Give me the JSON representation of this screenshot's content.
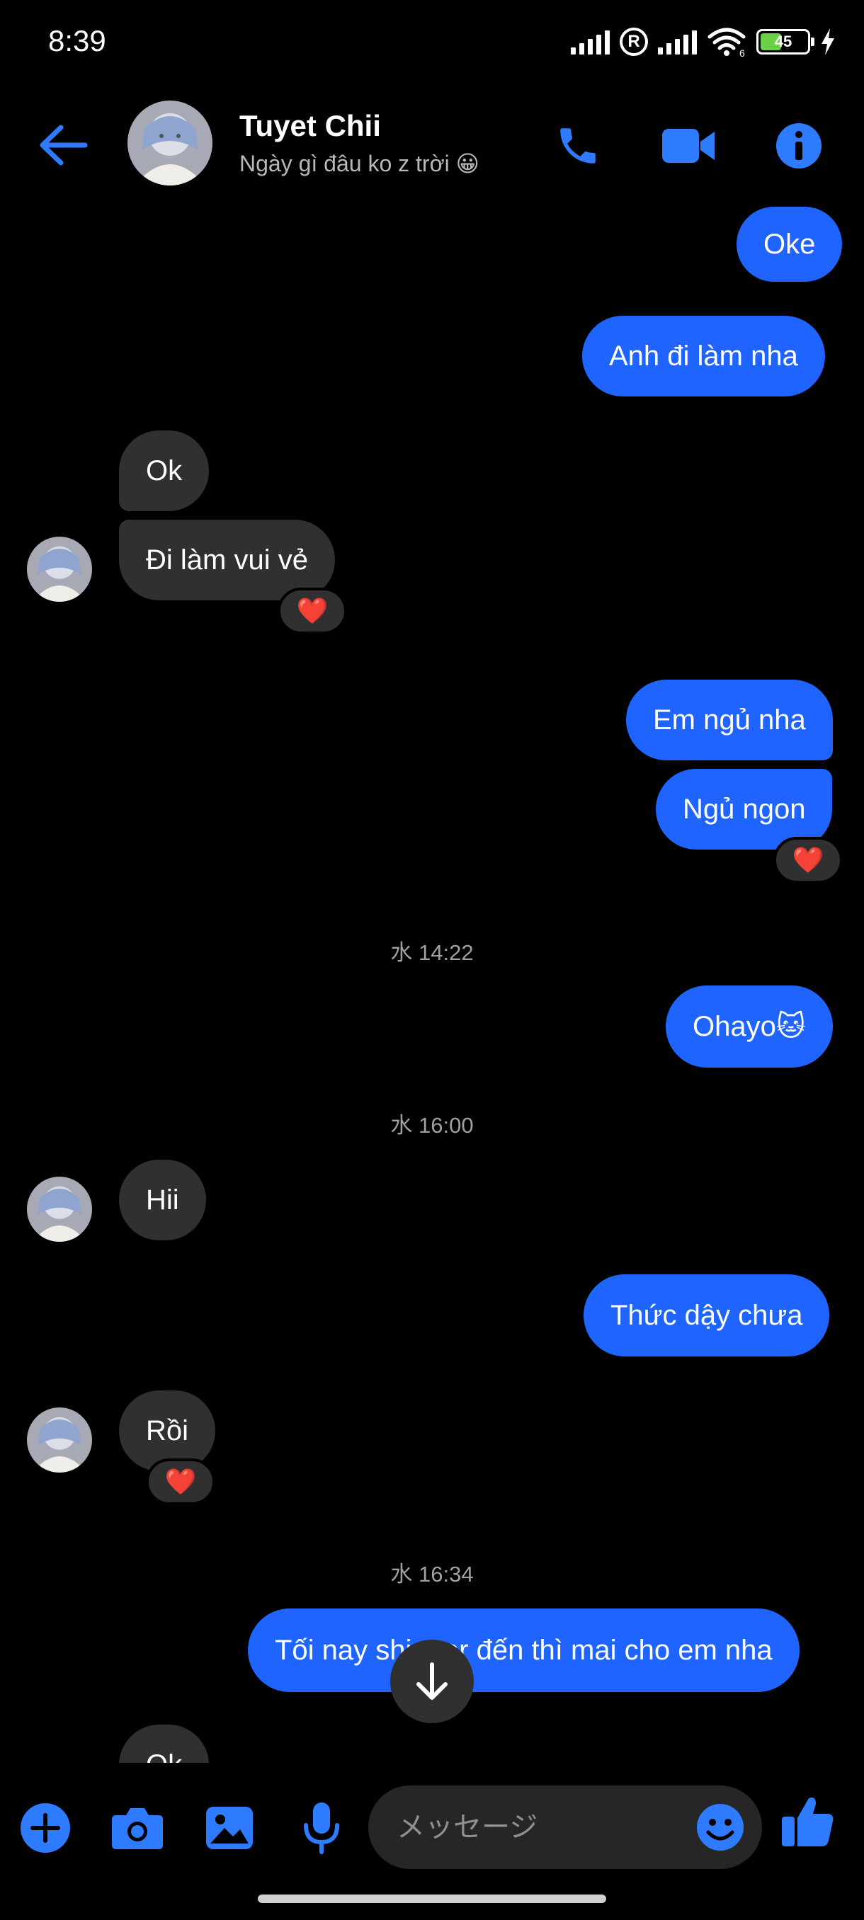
{
  "status_bar": {
    "time": "8:39",
    "battery": "45",
    "battery_level": 0.45,
    "network": "6"
  },
  "header": {
    "contact_name": "Tuyet Chii",
    "contact_status": "Ngày gì đâu ko z trời 😀",
    "back_icon": "arrow-left-icon",
    "call_icon": "phone-icon",
    "video_icon": "video-camera-icon",
    "info_icon": "info-icon"
  },
  "colors": {
    "accent": "#2064ff",
    "sent_bubble": "#2064ff",
    "received_bubble": "#303030",
    "background": "#000000",
    "reaction": "#ff2a40"
  },
  "messages": [
    {
      "dir": "sent",
      "text": "Oke"
    },
    {
      "dir": "sent",
      "text": "Anh đi làm nha"
    },
    {
      "dir": "received",
      "text": "Ok"
    },
    {
      "dir": "received",
      "text": "Đi làm vui vẻ",
      "reaction": "❤️"
    },
    {
      "dir": "sent",
      "text": "Em ngủ nha"
    },
    {
      "dir": "sent",
      "text": "Ngủ ngon",
      "reaction": "❤️"
    },
    {
      "timestamp": "水 14:22"
    },
    {
      "dir": "sent",
      "text": "Ohayo🐱"
    },
    {
      "timestamp": "水 16:00"
    },
    {
      "dir": "received",
      "text": "Hii"
    },
    {
      "dir": "sent",
      "text": "Thức dậy chưa"
    },
    {
      "dir": "received",
      "text": "Rồi",
      "reaction": "❤️"
    },
    {
      "timestamp": "水 16:34"
    },
    {
      "dir": "sent",
      "text": "Tối nay shipper đến thì mai cho em nha"
    },
    {
      "dir": "received",
      "text": "Ok"
    }
  ],
  "composer": {
    "placeholder": "メッセージ",
    "icons": [
      "plus-icon",
      "camera-icon",
      "gallery-icon",
      "microphone-icon",
      "emoji-icon",
      "thumbs-up-icon"
    ]
  }
}
